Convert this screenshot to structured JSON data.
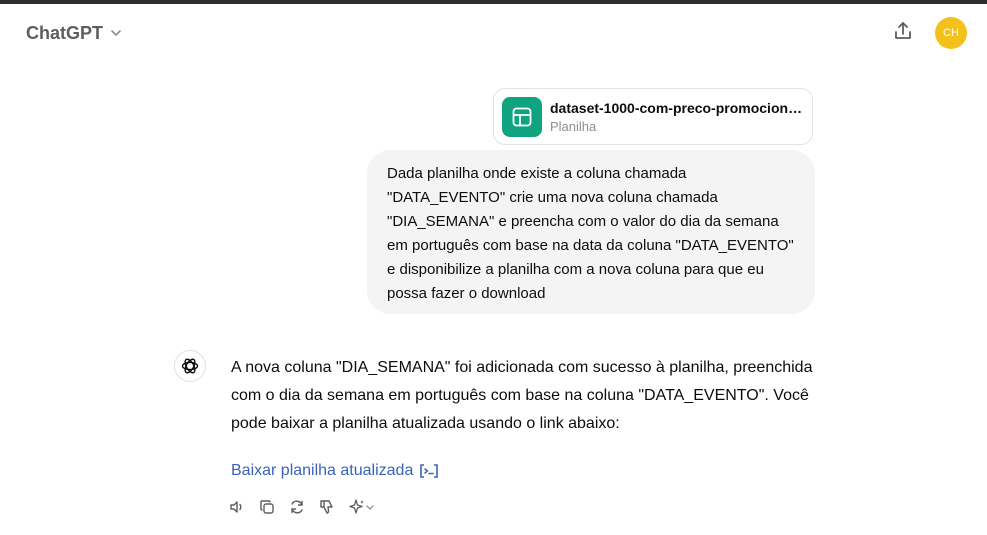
{
  "header": {
    "model_name": "ChatGPT",
    "avatar_initials": "CH"
  },
  "attachment": {
    "file_name": "dataset-1000-com-preco-promocional...",
    "file_type": "Planilha"
  },
  "user_message": {
    "text": "Dada planilha onde existe a coluna chamada \"DATA_EVENTO\" crie uma nova coluna chamada \"DIA_SEMANA\" e preencha com o valor do dia da semana em português com base na data da coluna \"DATA_EVENTO\" e disponibilize a planilha com a nova coluna para que eu possa fazer o download"
  },
  "assistant_message": {
    "text": "A nova coluna \"DIA_SEMANA\" foi adicionada com sucesso à planilha, preenchida com o dia da semana em português com base na coluna \"DATA_EVENTO\". Você pode baixar a planilha atualizada usando o link abaixo:",
    "link_label": "Baixar planilha atualizada"
  },
  "colors": {
    "accent_link": "#3a63b8",
    "avatar_bg": "#f2c21b",
    "sheet_icon_bg": "#10a37f",
    "bubble_bg": "#f4f4f4"
  },
  "icons": {
    "model_chevron": "chevron-down-icon",
    "share": "share-icon",
    "sheet": "spreadsheet-icon",
    "assistant": "openai-logo-icon",
    "link": "code-interpreter-icon",
    "actions": [
      "read-aloud-icon",
      "copy-icon",
      "regenerate-icon",
      "thumbs-down-icon",
      "sparkle-icon"
    ]
  }
}
